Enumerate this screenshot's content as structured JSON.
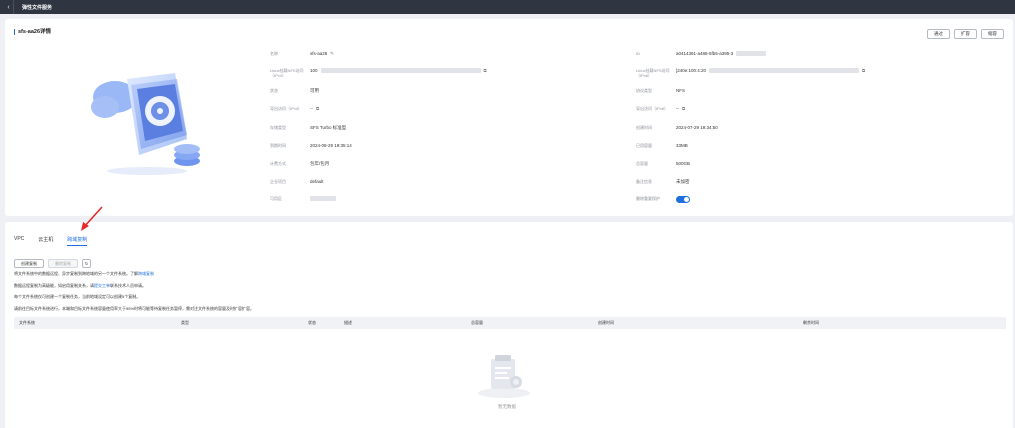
{
  "topbar": {
    "back_icon": "chevron-left-icon",
    "title": "弹性文件服务"
  },
  "detail": {
    "name": "sfs-aa26详情",
    "buttons": [
      "通过",
      "扩容",
      "缩容"
    ],
    "left_fields": [
      {
        "label": "名称",
        "value": "sfs-aa26",
        "icon": "✎"
      },
      {
        "label": "Linux挂载NFS访问（IPv4）",
        "value": "100",
        "icon": "⧉",
        "blurred": true
      },
      {
        "label": "状态",
        "value": "可用"
      },
      {
        "label": "导出访问（IPv4）",
        "value": "--",
        "icon": "⧉"
      },
      {
        "label": "存储类型",
        "value": "SFS Turbo 标准型"
      },
      {
        "label": "到期时间",
        "value": "2024-08-29 19:35:14"
      },
      {
        "label": "计费方式",
        "value": "包年/包月"
      },
      {
        "label": "企业项目",
        "value": "default"
      },
      {
        "label": "可用区",
        "value": "",
        "blurred": true
      }
    ],
    "right_fields": [
      {
        "label": "ID",
        "value": "a0414391-a488-5fb5-a395-3",
        "blurred": true
      },
      {
        "label": "Linux挂载NFS访问（IPv6）",
        "value": "[240e:100:4:20",
        "icon": "⧉",
        "blurred": true
      },
      {
        "label": "协议类型",
        "value": "NFS"
      },
      {
        "label": "导出访问（IPv6）",
        "value": "--",
        "icon": "⧉"
      },
      {
        "label": "创建时间",
        "value": "2024-07-29 19:34:50"
      },
      {
        "label": "已用容量",
        "value": "33MB"
      },
      {
        "label": "总容量",
        "value": "500GB"
      },
      {
        "label": "备注信息",
        "value": "未加密"
      },
      {
        "label": "删除重要保护",
        "value": "",
        "toggle": true
      }
    ]
  },
  "tabs": [
    "VPC",
    "云主机",
    "跨域复制"
  ],
  "active_tab": 2,
  "replication": {
    "create_button": "创建复制",
    "delete_button": "删除复制",
    "refresh_icon": "refresh-icon",
    "notes": [
      {
        "text": "将文件系统中的数据远程、异步复制到跨地域的另一个文件系统。了解",
        "link": "跨域复制"
      },
      {
        "text": "数据远程复制为高级能，如启用复制关系，请",
        "link": "提交工单",
        "after": "联系技术人员申请。"
      },
      {
        "text": "每个文件系统仅可创建一个复制任务，当前地域设定可以创建5个复制。"
      },
      {
        "text": "请前往目标文件系统进行，本端和目标文件系统容量使用率大于95%时将可能等待复制任务暂停，需对注文件系统的容量及时扩容扩容。"
      }
    ],
    "columns": [
      "文件系统",
      "类型",
      "状态",
      "描述",
      "总容量",
      "创建时间",
      "剩余时间"
    ],
    "empty_text": "暂无数据"
  },
  "colors": {
    "accent": "#1f6fe0",
    "topbar": "#2f3541",
    "arrow": "#e32b2b"
  }
}
